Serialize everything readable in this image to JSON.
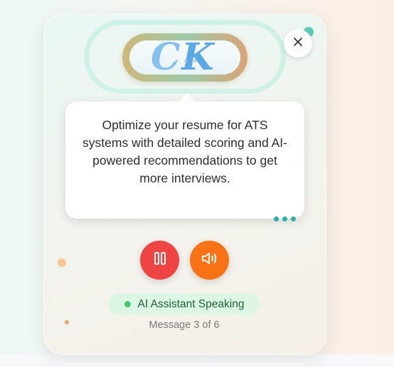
{
  "assistant": {
    "avatar_letters": "CK",
    "message": "Optimize your resume for ATS systems with detailed scoring and AI-powered recommendations to get more interviews.",
    "status": "AI Assistant Speaking",
    "counter": "Message 3 of 6"
  },
  "controls": {
    "close_icon": "close-icon",
    "pause_icon": "pause-icon",
    "volume_icon": "volume-icon"
  },
  "colors": {
    "pause_button": "#ef4444",
    "volume_button": "#f97316",
    "status_pill": "#dcf5e4",
    "status_dot": "#48c774",
    "typing_dots": "#26b3a5"
  }
}
